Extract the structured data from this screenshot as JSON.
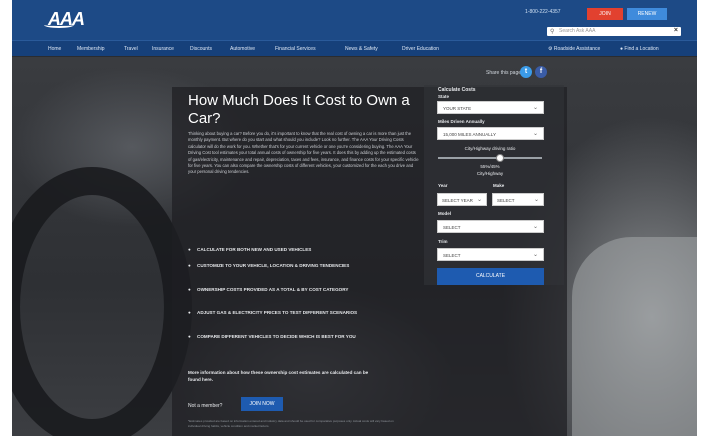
{
  "header": {
    "logo": "AAA",
    "phone": "1-800-222-4357",
    "join_label": "JOIN",
    "renew_label": "RENEW",
    "search_placeholder": "Search Ask AAA"
  },
  "nav": {
    "left": [
      "Home",
      "Membership",
      "Travel",
      "Insurance",
      "Discounts",
      "Automotive",
      "Financial Services",
      "News & Safety",
      "Driver Education"
    ],
    "right": [
      "Roadside Assistance",
      "Find a Location"
    ]
  },
  "share": {
    "label": "Share this page:"
  },
  "article": {
    "title": "How Much Does It Cost to Own a Car?",
    "intro": "Thinking about buying a car? Before you do, it's important to know that the real cost of owning a car is more than just the monthly payment. But where do you start and what should you include? Look no further. The AAA Your Driving Costs calculator will do the work for you. Whether that's for your current vehicle or one you're considering buying. The AAA Your Driving Cost tool estimates your total annual costs of ownership for five years. It does this by adding up the estimated costs of gas/electricity, maintenance and repair, depreciation, taxes and fees, insurance, and finance costs for your specific vehicle for five years. You can also compare the ownership costs of different vehicles, your customized for the each you drive and your personal driving tendencies.",
    "bullets": [
      "CALCULATE FOR BOTH NEW AND USED VEHICLES",
      "CUSTOMIZE TO YOUR VEHICLE, LOCATION & DRIVING TENDENCIES",
      "OWNERSHIP COSTS PROVIDED AS A TOTAL & BY COST CATEGORY",
      "ADJUST GAS & ELECTRICITY PRICES TO TEST DIFFERENT SCENARIOS",
      "COMPARE DIFFERENT VEHICLES TO DECIDE WHICH IS BEST FOR YOU"
    ],
    "more": "More information about how these ownership cost estimates are calculated can be found here.",
    "not_member": "Not a member?",
    "join_now": "JOIN NOW",
    "fine": "*Estimates provided are based on information entered and industry data and should be used for comparative purposes only. Actual costs will vary based on individual driving habits, vehicle condition and market factors."
  },
  "calculator": {
    "heading": "Calculate Costs",
    "state_label": "State",
    "state_value": "YOUR STATE",
    "miles_label": "Miles Driven Annually",
    "miles_value": "15,000 MILES ANNUALLY",
    "split_label": "City/Highway driving ratio",
    "split_value": "55%/45%",
    "split_sub": "City/Highway",
    "year_label": "Year",
    "year_value": "SELECT YEAR",
    "make_label": "Make",
    "make_value": "SELECT",
    "model_label": "Model",
    "model_value": "SELECT",
    "trim_label": "Trim",
    "trim_value": "SELECT",
    "button": "CALCULATE"
  },
  "colors": {
    "brand": "#1d4a86",
    "join": "#e2412f",
    "renew": "#3f8bdc",
    "cta": "#1e5bb0"
  }
}
